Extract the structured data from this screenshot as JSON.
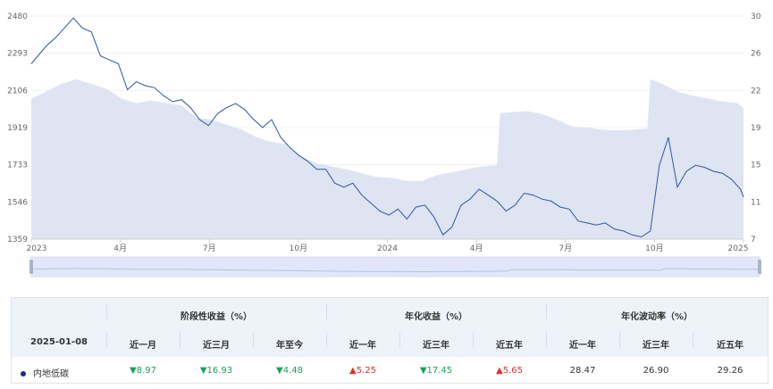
{
  "chart_data": {
    "type": "line",
    "x_ticks": [
      "2023",
      "4月",
      "7月",
      "10月",
      "2024",
      "4月",
      "7月",
      "10月",
      "2025"
    ],
    "y_left_ticks": [
      2480,
      2293,
      2106,
      1919,
      1733,
      1546,
      1359
    ],
    "y_right_ticks": [
      30,
      26,
      22,
      19,
      15,
      11,
      7
    ],
    "ylim_left": [
      1359,
      2480
    ],
    "ylim_right": [
      7,
      30
    ],
    "series": [
      {
        "name": "",
        "axis": "left",
        "kind": "line",
        "color": "#2f55a4",
        "x": [
          0,
          0.5,
          0.8,
          1.1,
          1.4,
          1.7,
          2.0,
          2.3,
          2.6,
          2.9,
          3.2,
          3.5,
          3.8,
          4.1,
          4.4,
          4.7,
          5.0,
          5.3,
          5.6,
          5.9,
          6.2,
          6.5,
          6.8,
          7.1,
          7.4,
          7.7,
          8.0,
          8.3,
          8.6,
          8.9,
          9.2,
          9.5,
          9.8,
          10.1,
          10.4,
          10.7,
          11.0,
          11.3,
          11.6,
          11.9,
          12.2,
          12.5,
          12.8,
          13.1,
          13.4,
          13.7,
          14.0,
          14.3,
          14.6,
          14.9,
          15.2,
          15.5,
          15.8,
          16.1,
          16.4,
          16.7,
          17.0,
          17.3,
          17.6,
          17.9,
          18.2,
          18.5,
          18.8,
          19.1,
          19.4,
          19.7,
          20.0,
          20.3,
          20.6,
          20.9,
          21.2,
          21.5,
          21.8,
          22.1,
          22.4,
          22.7,
          23.0,
          23.3,
          23.6,
          23.7
        ],
        "values": [
          2240,
          2330,
          2370,
          2420,
          2470,
          2420,
          2400,
          2280,
          2260,
          2240,
          2110,
          2150,
          2130,
          2120,
          2080,
          2050,
          2060,
          2020,
          1960,
          1930,
          1990,
          2020,
          2040,
          2010,
          1960,
          1920,
          1960,
          1870,
          1820,
          1780,
          1750,
          1710,
          1710,
          1640,
          1620,
          1640,
          1580,
          1540,
          1500,
          1480,
          1510,
          1460,
          1520,
          1530,
          1470,
          1380,
          1420,
          1530,
          1560,
          1610,
          1580,
          1550,
          1500,
          1530,
          1590,
          1580,
          1560,
          1550,
          1520,
          1510,
          1450,
          1440,
          1430,
          1440,
          1410,
          1400,
          1380,
          1370,
          1400,
          1730,
          1870,
          1620,
          1700,
          1730,
          1720,
          1700,
          1690,
          1660,
          1610,
          1570
        ]
      },
      {
        "name": "",
        "axis": "right",
        "kind": "area",
        "color": "#dfe4f2",
        "x": [
          0,
          0.5,
          1.0,
          1.5,
          2.0,
          2.5,
          3.0,
          3.5,
          4.0,
          4.5,
          5.0,
          5.5,
          6.0,
          6.5,
          7.0,
          7.5,
          8.0,
          8.5,
          9.0,
          9.5,
          10.0,
          10.5,
          11.0,
          11.5,
          12.0,
          12.5,
          13.0,
          13.5,
          14.0,
          14.5,
          15.0,
          15.5,
          15.6,
          16.0,
          16.5,
          17.0,
          17.5,
          18.0,
          18.5,
          19.0,
          19.5,
          20.0,
          20.5,
          20.6,
          21.0,
          21.5,
          22.0,
          22.5,
          23.0,
          23.5,
          23.7
        ],
        "values": [
          21.5,
          22.2,
          23.0,
          23.5,
          23.0,
          22.5,
          21.5,
          21.0,
          21.3,
          21.0,
          20.8,
          19.5,
          19.3,
          18.8,
          18.3,
          17.5,
          17.0,
          16.8,
          15.5,
          14.8,
          14.5,
          14.2,
          13.8,
          13.4,
          13.3,
          13.0,
          13.0,
          13.6,
          13.9,
          14.2,
          14.5,
          14.6,
          20.0,
          20.1,
          20.2,
          19.9,
          19.3,
          18.6,
          18.5,
          18.3,
          18.2,
          18.3,
          18.4,
          23.5,
          23.0,
          22.2,
          21.8,
          21.5,
          21.2,
          21.0,
          20.5
        ]
      }
    ]
  },
  "table": {
    "groups": [
      "阶段性收益（%）",
      "年化收益（%）",
      "年化波动率（%）"
    ],
    "date": "2025-01-08",
    "columns": [
      "近一月",
      "近三月",
      "年至今",
      "近一年",
      "近三年",
      "近五年",
      "近一年",
      "近三年",
      "近五年"
    ],
    "row": {
      "name": "内地低碳",
      "values": [
        "8.97",
        "16.93",
        "4.48",
        "5.25",
        "17.45",
        "5.65",
        "28.47",
        "26.90",
        "29.26"
      ],
      "arrows": [
        "▼",
        "▼",
        "▼",
        "▲",
        "▼",
        "▲",
        "",
        "",
        ""
      ]
    }
  }
}
